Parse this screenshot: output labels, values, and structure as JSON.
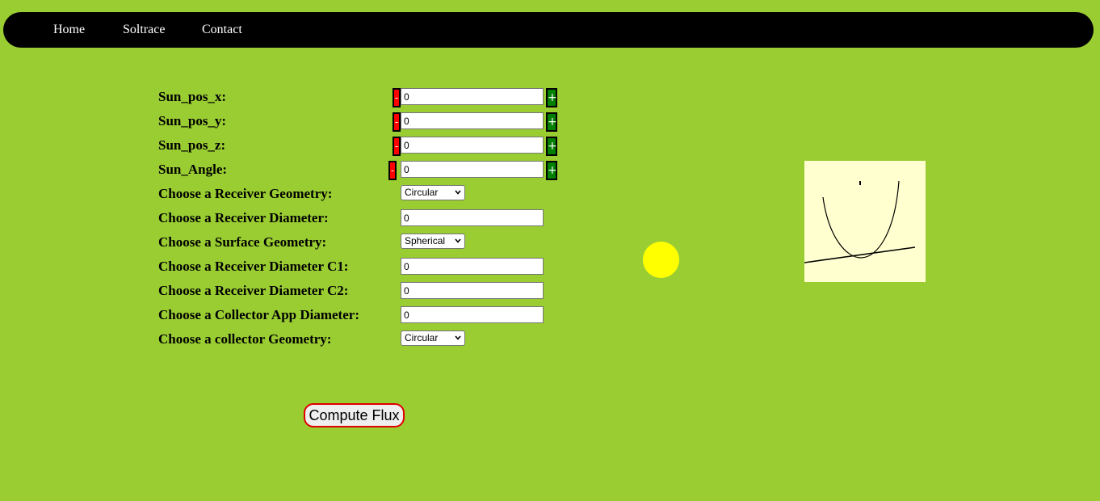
{
  "nav": {
    "items": [
      {
        "label": "Home"
      },
      {
        "label": "Soltrace"
      },
      {
        "label": "Contact"
      }
    ]
  },
  "steppers": [
    {
      "label": "Sun_pos_x:",
      "value": "0",
      "minus": "-",
      "plus": "+"
    },
    {
      "label": "Sun_pos_y:",
      "value": "0",
      "minus": "-",
      "plus": "+"
    },
    {
      "label": "Sun_pos_z:",
      "value": "0",
      "minus": "-",
      "plus": "+"
    },
    {
      "label": "Sun_Angle:",
      "value": "0",
      "minus": "-",
      "plus": "+"
    }
  ],
  "fields": {
    "receiver_geometry": {
      "label": "Choose a Receiver Geometry:",
      "selected": "Circular"
    },
    "receiver_diameter": {
      "label": "Choose a Receiver Diameter:",
      "value": "0"
    },
    "surface_geometry": {
      "label": "Choose a Surface Geometry:",
      "selected": "Spherical"
    },
    "receiver_diameter_c1": {
      "label": "Choose a Receiver Diameter C1:",
      "value": "0"
    },
    "receiver_diameter_c2": {
      "label": "Choose a Receiver Diameter C2:",
      "value": "0"
    },
    "collector_app_diameter": {
      "label": "Choose a Collector App Diameter:",
      "value": "0"
    },
    "collector_geometry": {
      "label": "Choose a collector Geometry:",
      "selected": "Circular"
    }
  },
  "compute_button": {
    "label": "Compute Flux"
  },
  "colors": {
    "background": "#9acd32",
    "navbar": "#000000",
    "minus": "#ff0000",
    "plus": "#008000",
    "sun": "#ffff00",
    "canvas": "#ffffd0"
  }
}
